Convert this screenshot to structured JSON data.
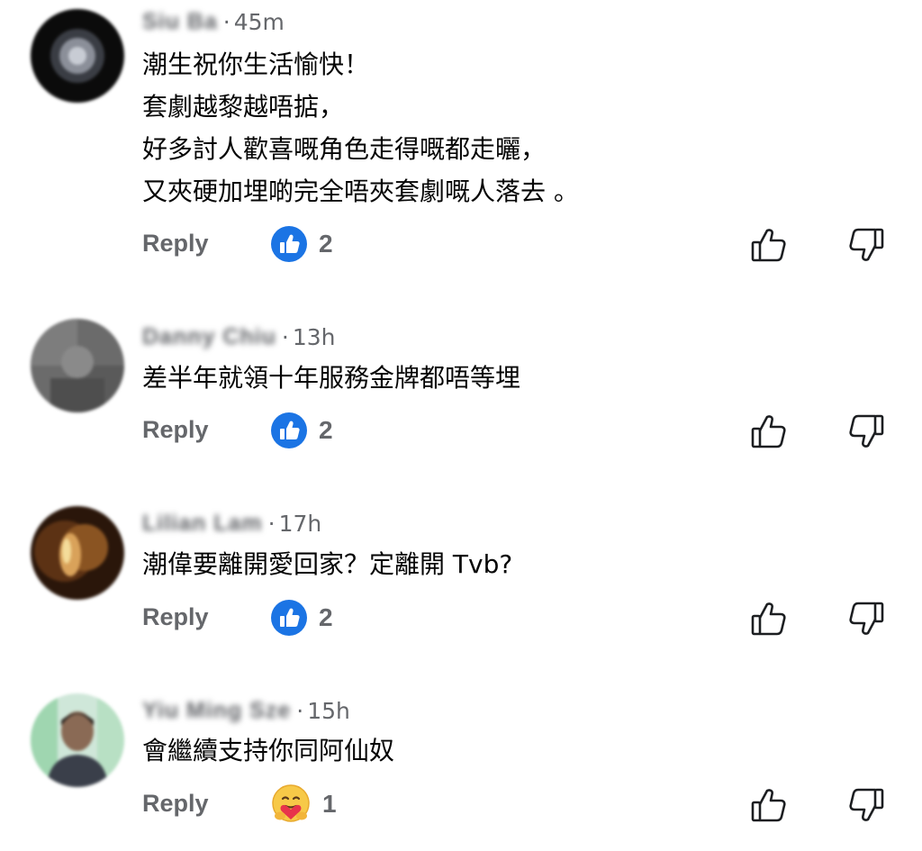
{
  "comments": [
    {
      "author": "Siu Ba",
      "time": "45m",
      "lines": [
        "潮生祝你生活愉快！",
        "套劇越黎越唔掂，",
        "好多討人歡喜嘅角色走得嘅都走曬，",
        "又夾硬加埋啲完全唔夾套劇嘅人落去 。"
      ],
      "reply_label": "Reply",
      "reaction_icon": "like-badge-icon",
      "reaction_count": "2"
    },
    {
      "author": "Danny Chiu",
      "time": "13h",
      "lines": [
        "差半年就領十年服務金牌都唔等埋"
      ],
      "reply_label": "Reply",
      "reaction_icon": "like-badge-icon",
      "reaction_count": "2"
    },
    {
      "author": "Lilian Lam",
      "time": "17h",
      "lines": [
        "潮偉要離開愛回家？定離開 Tvb?"
      ],
      "reply_label": "Reply",
      "reaction_icon": "like-badge-icon",
      "reaction_count": "2"
    },
    {
      "author": "Yiu Ming Sze",
      "time": "15h",
      "lines": [
        "會繼續支持你同阿仙奴"
      ],
      "reply_label": "Reply",
      "reaction_icon": "care-emoji-icon",
      "reaction_count": "1"
    }
  ],
  "colors": {
    "like_blue": "#1b74e4",
    "meta_gray": "#65676b",
    "text": "#050505"
  }
}
